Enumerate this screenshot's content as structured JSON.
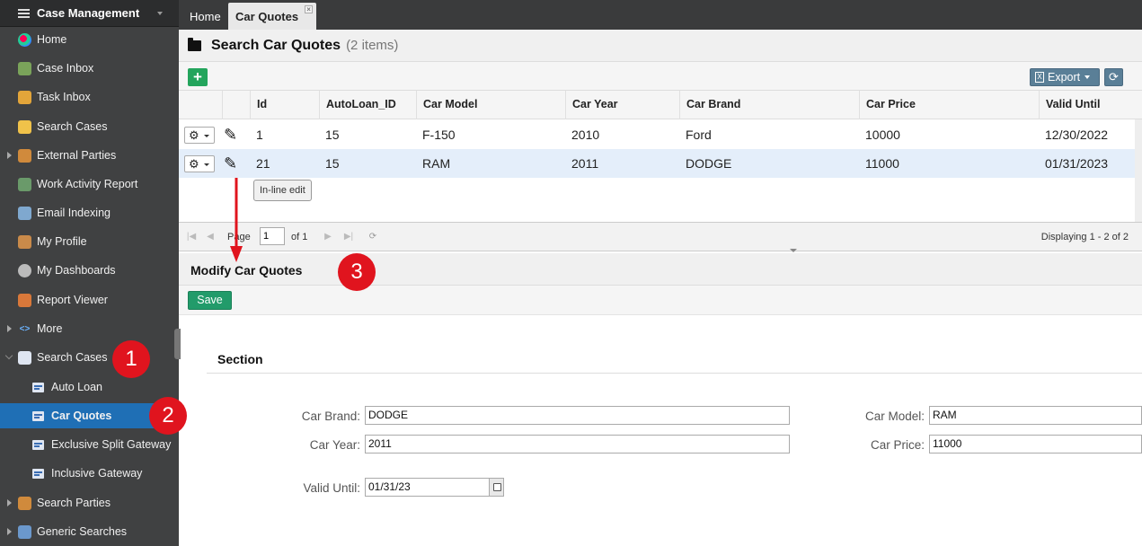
{
  "sidebar": {
    "title": "Case Management",
    "items": [
      {
        "label": "Home",
        "icon": "pie-chart-icon"
      },
      {
        "label": "Case Inbox",
        "icon": "inbox-icon"
      },
      {
        "label": "Task Inbox",
        "icon": "clipboard-icon"
      },
      {
        "label": "Search Cases",
        "icon": "folder-search-icon"
      },
      {
        "label": "External Parties",
        "icon": "people-icon"
      },
      {
        "label": "Work Activity Report",
        "icon": "report-icon"
      },
      {
        "label": "Email Indexing",
        "icon": "email-icon"
      },
      {
        "label": "My Profile",
        "icon": "user-icon"
      },
      {
        "label": "My Dashboards",
        "icon": "dashboard-icon"
      },
      {
        "label": "Report Viewer",
        "icon": "report-viewer-icon"
      },
      {
        "label": "More",
        "icon": "code-icon"
      },
      {
        "label": "Search Cases",
        "icon": "grid-icon"
      },
      {
        "label": "Auto Loan",
        "icon": "form-icon"
      },
      {
        "label": "Car Quotes",
        "icon": "form-icon"
      },
      {
        "label": "Exclusive Split Gateway",
        "icon": "form-icon"
      },
      {
        "label": "Inclusive Gateway",
        "icon": "form-icon"
      },
      {
        "label": "Search Parties",
        "icon": "people-icon"
      },
      {
        "label": "Generic Searches",
        "icon": "search-grid-icon"
      }
    ]
  },
  "tabs": {
    "home": "Home",
    "car_quotes": "Car Quotes",
    "close": "×"
  },
  "search": {
    "title": "Search Car Quotes",
    "count": "(2 items)",
    "add": "+",
    "export": "Export",
    "refresh": "⟳"
  },
  "grid": {
    "columns": [
      "Id",
      "AutoLoan_ID",
      "Car Model",
      "Car Year",
      "Car Brand",
      "Car Price",
      "Valid Until"
    ],
    "rows": [
      {
        "id": "1",
        "autoloan_id": "15",
        "car_model": "F-150",
        "car_year": "2010",
        "car_brand": "Ford",
        "car_price": "10000",
        "valid_until": "12/30/2022"
      },
      {
        "id": "21",
        "autoloan_id": "15",
        "car_model": "RAM",
        "car_year": "2011",
        "car_brand": "DODGE",
        "car_price": "11000",
        "valid_until": "01/31/2023"
      }
    ],
    "tooltip": "In-line edit"
  },
  "pager": {
    "page_label": "Page",
    "page_value": "1",
    "of": "of 1",
    "displaying": "Displaying 1 - 2 of 2"
  },
  "modify": {
    "title": "Modify Car Quotes",
    "save": "Save",
    "section": "Section",
    "fields": {
      "car_brand_label": "Car Brand:",
      "car_brand_value": "DODGE",
      "car_year_label": "Car Year:",
      "car_year_value": "2011",
      "valid_until_label": "Valid Until:",
      "valid_until_value": "01/31/23",
      "car_model_label": "Car Model:",
      "car_model_value": "RAM",
      "car_price_label": "Car Price:",
      "car_price_value": "11000"
    }
  },
  "annotations": {
    "one": "1",
    "two": "2",
    "three": "3"
  },
  "colors": {
    "sidebar_bg": "#404142",
    "active": "#1f6fb5",
    "add_green": "#23a45c",
    "annotation_red": "#e0141e"
  }
}
